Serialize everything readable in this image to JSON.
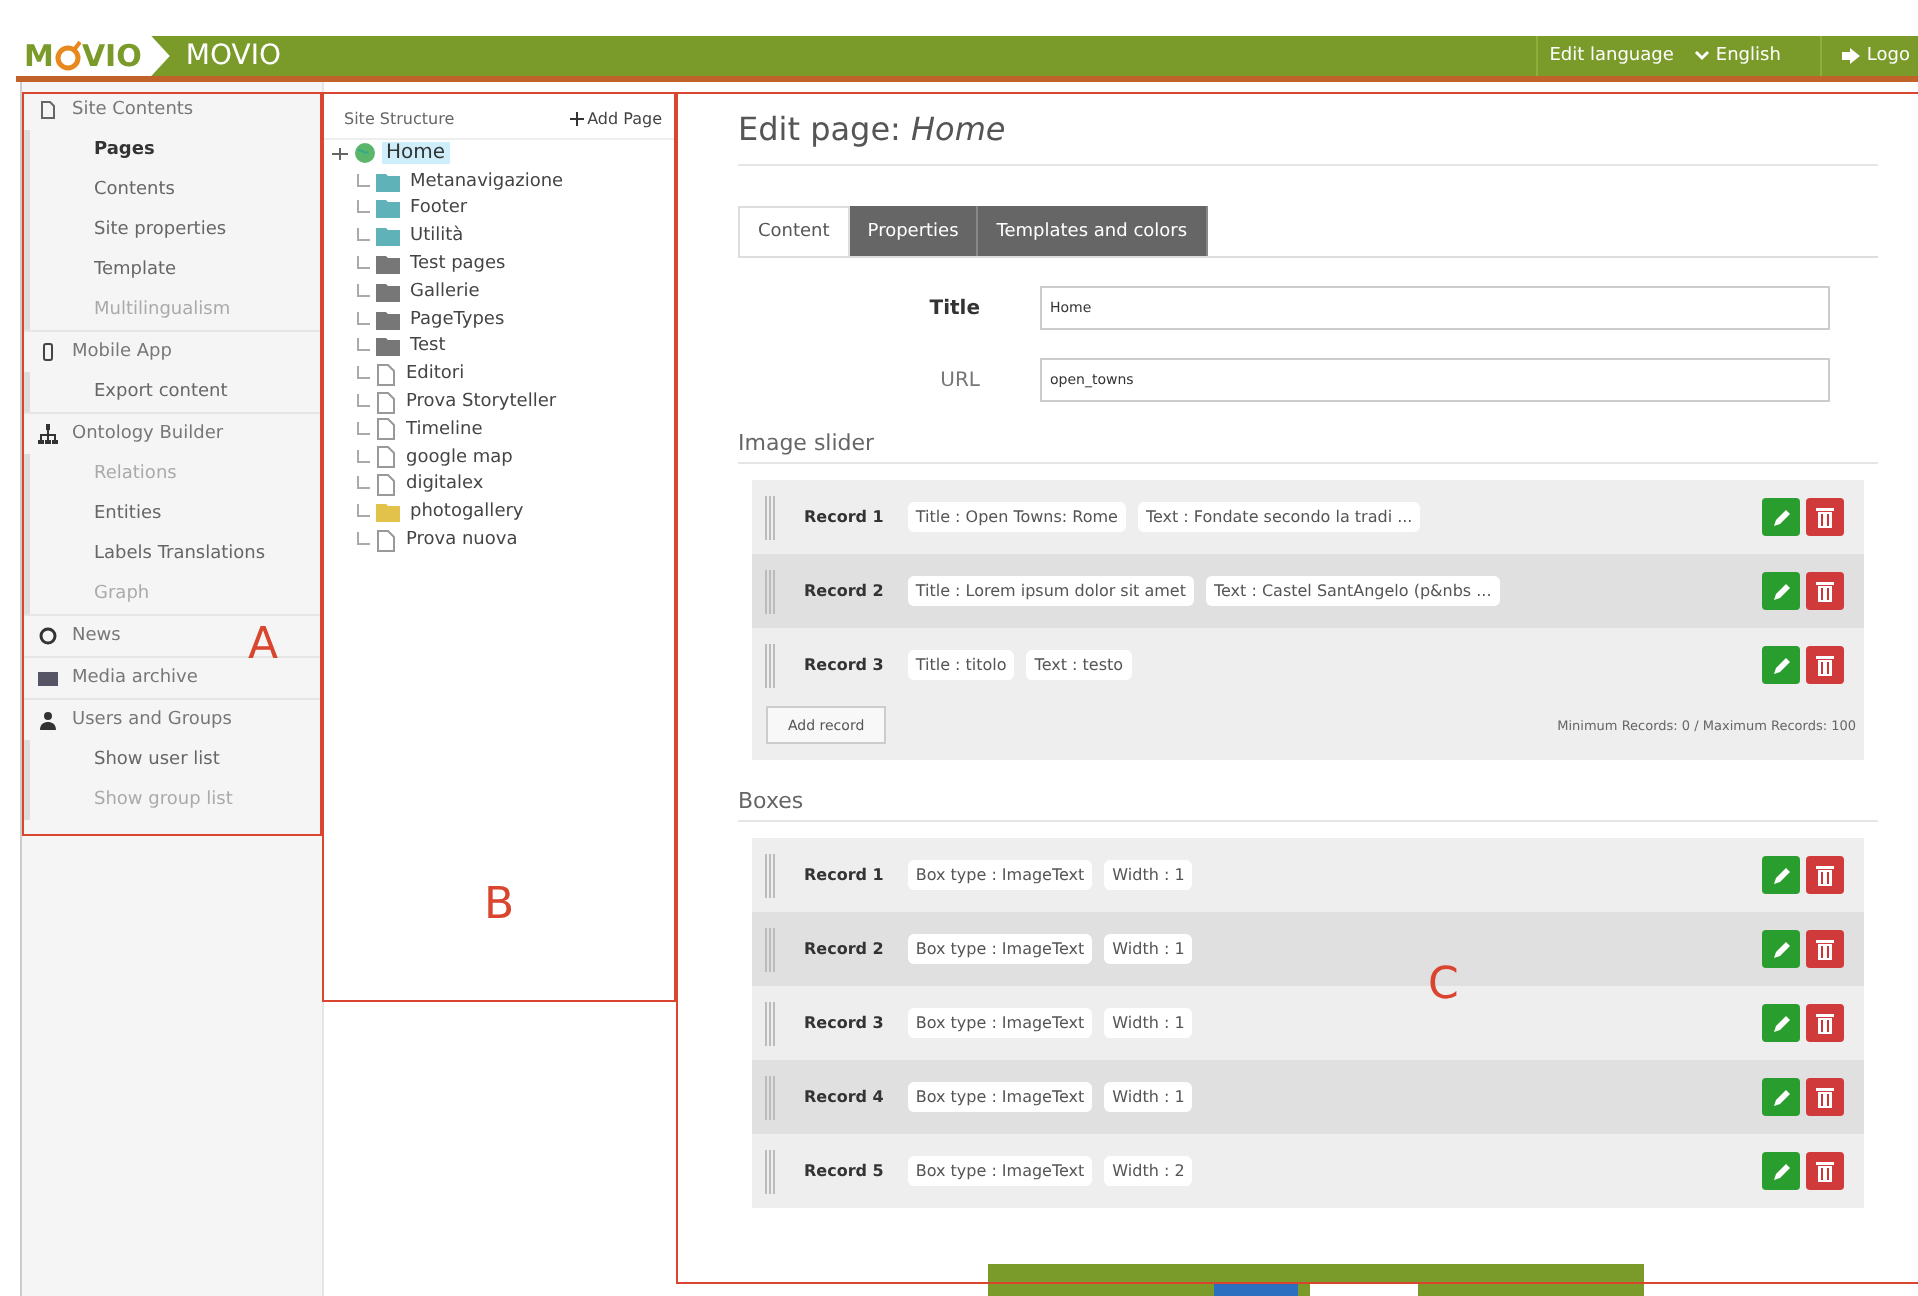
{
  "header": {
    "logo_before": "M",
    "logo_after": "VIO",
    "brand": "MOVIO",
    "edit_language": "Edit language",
    "language": "English",
    "logout": "Logo"
  },
  "sidebar": [
    {
      "label": "Site Contents",
      "items": [
        {
          "label": "Pages",
          "selected": true,
          "disabled": false
        },
        {
          "label": "Contents",
          "selected": false,
          "disabled": false
        },
        {
          "label": "Site properties",
          "selected": false,
          "disabled": false
        },
        {
          "label": "Template",
          "selected": false,
          "disabled": false
        },
        {
          "label": "Multilingualism",
          "selected": false,
          "disabled": true
        }
      ]
    },
    {
      "label": "Mobile App",
      "items": [
        {
          "label": "Export content",
          "selected": false,
          "disabled": false
        }
      ]
    },
    {
      "label": "Ontology Builder",
      "items": [
        {
          "label": "Relations",
          "selected": false,
          "disabled": true
        },
        {
          "label": "Entities",
          "selected": false,
          "disabled": false
        },
        {
          "label": "Labels Translations",
          "selected": false,
          "disabled": false
        },
        {
          "label": "Graph",
          "selected": false,
          "disabled": true
        }
      ]
    },
    {
      "label": "News"
    },
    {
      "label": "Media archive"
    },
    {
      "label": "Users and Groups",
      "items": [
        {
          "label": "Show user list",
          "selected": false,
          "disabled": false
        },
        {
          "label": "Show group list",
          "selected": false,
          "disabled": true
        }
      ]
    }
  ],
  "site_structure": {
    "title": "Site Structure",
    "add_page": "Add Page",
    "tree": [
      {
        "label": "Home",
        "selected": true,
        "children": [
          {
            "label": "Metanavigazione",
            "kind": "section",
            "selected": false
          },
          {
            "label": "Footer",
            "kind": "section",
            "selected": false
          },
          {
            "label": "Utilità",
            "kind": "section",
            "selected": false
          },
          {
            "label": "Test pages",
            "kind": "folder",
            "selected": false
          },
          {
            "label": "Gallerie",
            "kind": "folder",
            "selected": false
          },
          {
            "label": "PageTypes",
            "kind": "folder",
            "selected": false
          },
          {
            "label": "Test",
            "kind": "folder",
            "selected": false
          },
          {
            "label": "Editori",
            "kind": "page",
            "selected": false
          },
          {
            "label": "Prova Storyteller",
            "kind": "page",
            "selected": false
          },
          {
            "label": "Timeline",
            "kind": "page",
            "selected": false
          },
          {
            "label": "google map",
            "kind": "page",
            "selected": false
          },
          {
            "label": "digitalex",
            "kind": "page",
            "selected": false
          },
          {
            "label": "photogallery",
            "kind": "gallery",
            "selected": false
          },
          {
            "label": "Prova nuova",
            "kind": "page",
            "selected": false
          }
        ]
      }
    ]
  },
  "page_title": "Edit page: *Home*",
  "tabs": [
    {
      "label": "Content",
      "selected": true
    },
    {
      "label": "Properties",
      "selected": false
    },
    {
      "label": "Templates and colors",
      "selected": false
    }
  ],
  "fields": [
    {
      "label": "Title",
      "value": "Home",
      "required": true
    },
    {
      "label": "URL",
      "value": "open_towns",
      "required": false
    }
  ],
  "sections": [
    {
      "title": "Image slider",
      "records": [
        {
          "label": "Record 1",
          "values": [
            "Title : Open Towns: Rome",
            "Text : Fondate secondo la tradi ..."
          ]
        },
        {
          "label": "Record 2",
          "values": [
            "Title : Lorem ipsum dolor sit amet",
            "Text : Castel SantAngelo (p&nbs ..."
          ]
        },
        {
          "label": "Record 3",
          "values": [
            "Title : titolo",
            "Text : testo"
          ]
        }
      ],
      "add_record": "Add record",
      "limits": "Minimum Records: 0 / Maximum Records: 100"
    },
    {
      "title": "Boxes",
      "records": [
        {
          "label": "Record 1",
          "values": [
            "Box type : ImageText",
            "Width : 1"
          ]
        },
        {
          "label": "Record 2",
          "values": [
            "Box type : ImageText",
            "Width : 1"
          ]
        },
        {
          "label": "Record 3",
          "values": [
            "Box type : ImageText",
            "Width : 1"
          ]
        },
        {
          "label": "Record 4",
          "values": [
            "Box type : ImageText",
            "Width : 1"
          ]
        },
        {
          "label": "Record 5",
          "values": [
            "Box type : ImageText",
            "Width : 2"
          ]
        }
      ]
    }
  ],
  "annotations": [
    "A",
    "B",
    "C"
  ]
}
